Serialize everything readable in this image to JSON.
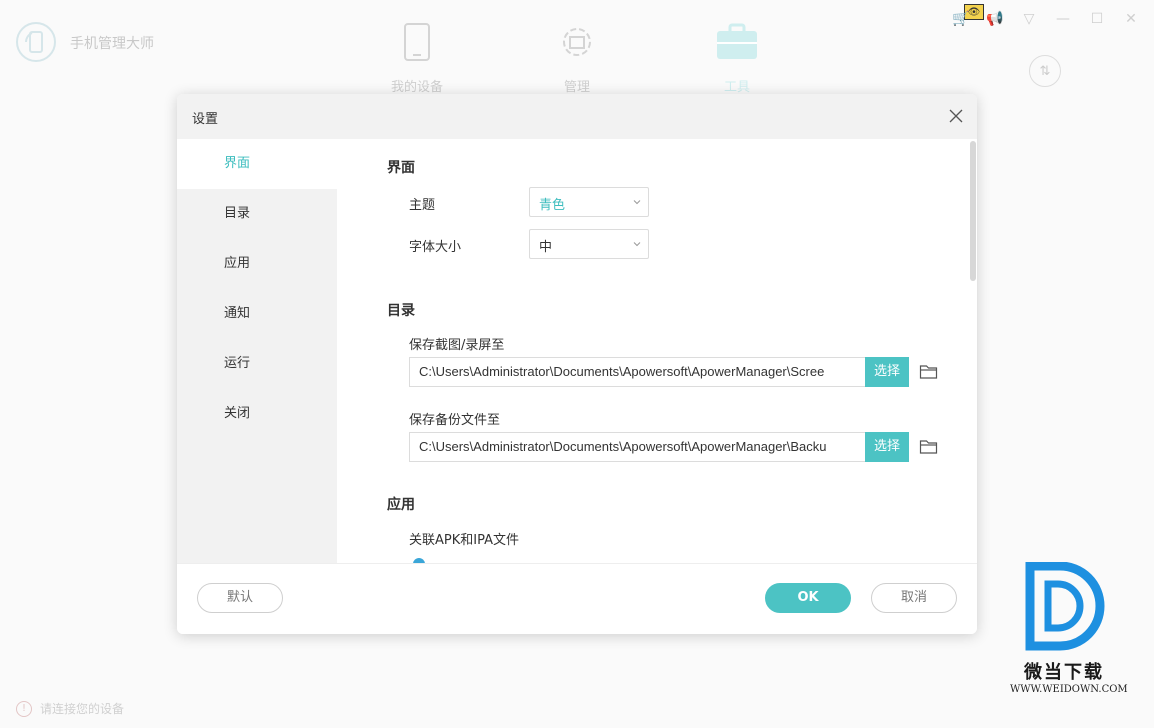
{
  "app": {
    "name": "手机管理大师",
    "tabs": [
      {
        "label": "我的设备",
        "icon": "phone-icon"
      },
      {
        "label": "管理",
        "icon": "gear-icon"
      },
      {
        "label": "工具",
        "icon": "toolbox-icon"
      }
    ],
    "status_hint": "请连接您的设备"
  },
  "dialog": {
    "title": "设置",
    "sidebar": [
      {
        "label": "界面",
        "active": true
      },
      {
        "label": "目录",
        "active": false
      },
      {
        "label": "应用",
        "active": false
      },
      {
        "label": "通知",
        "active": false
      },
      {
        "label": "运行",
        "active": false
      },
      {
        "label": "关闭",
        "active": false
      }
    ],
    "interface": {
      "title": "界面",
      "theme_label": "主题",
      "theme_value": "青色",
      "font_label": "字体大小",
      "font_value": "中"
    },
    "directory": {
      "title": "目录",
      "screenshot_label": "保存截图/录屏至",
      "screenshot_path": "C:\\Users\\Administrator\\Documents\\Apowersoft\\ApowerManager\\Scree",
      "backup_label": "保存备份文件至",
      "backup_path": "C:\\Users\\Administrator\\Documents\\Apowersoft\\ApowerManager\\Backu",
      "choose_label": "选择"
    },
    "apps": {
      "title": "应用",
      "assoc_label": "关联APK和IPA文件"
    },
    "footer": {
      "default_label": "默认",
      "ok_label": "OK",
      "cancel_label": "取消"
    }
  },
  "colors": {
    "accent": "#4cc3c4",
    "accent_text": "#3dbdbe"
  },
  "watermark": {
    "name": "微当下载",
    "url": "WWW.WEIDOWN.COM"
  }
}
